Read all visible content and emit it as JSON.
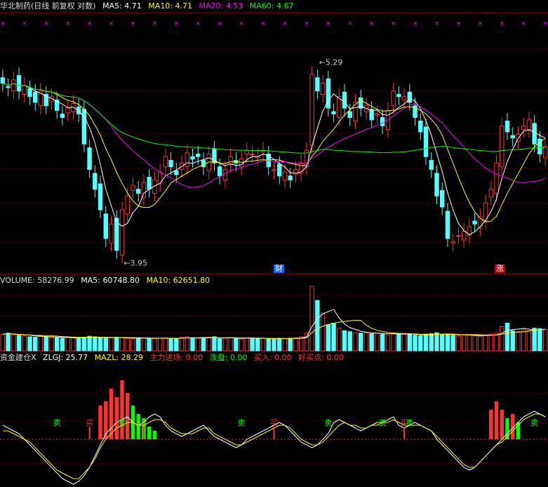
{
  "header": {
    "stock_title": "华北制药(日线 前复权 对数)",
    "ma5": "MA5: 4.71",
    "ma10": "MA10: 4.71",
    "ma20": "MA20: 4.53",
    "ma60": "MA60: 4.67"
  },
  "volume_header": {
    "volume": "VOLUME: 58276.99",
    "ma5": "MA5: 60748.80",
    "ma10": "MA10: 62651.80"
  },
  "indicator_header": {
    "name": "资金建仓X",
    "zlgj": "ZLGJ: 25.77",
    "mazl": "MAZL: 28.29",
    "zljc": "主力进场: 0.00",
    "xp": "洗盘: 0.00",
    "mr": "买入: 0.00",
    "hmd": "好买点: 0.00"
  },
  "annotations": {
    "high": "5.29",
    "low": "3.95",
    "cai": "财",
    "zhang": "涨",
    "sell": "卖",
    "buy": "买"
  },
  "colors": {
    "up": "#ff3232",
    "down": "#54ffff",
    "ma5": "#ffffff",
    "ma10": "#ffff00",
    "ma20": "#ff00ff",
    "ma60": "#00ff00",
    "grid": "#8b0000",
    "sell": "#00ff00",
    "buy": "#ff3232"
  },
  "chart_data": {
    "type": "candlestick",
    "panels": [
      "price",
      "volume",
      "indicator"
    ],
    "price_range": [
      3.55,
      5.5
    ],
    "close": [
      4.92,
      4.88,
      4.95,
      4.85,
      4.9,
      4.8,
      4.75,
      4.85,
      4.72,
      4.8,
      4.68,
      4.62,
      4.7,
      4.74,
      4.65,
      4.4,
      4.2,
      4.05,
      3.9,
      3.7,
      3.8,
      3.62,
      3.9,
      4.0,
      4.08,
      4.02,
      4.1,
      4.05,
      4.12,
      4.18,
      4.3,
      4.22,
      4.16,
      4.25,
      4.33,
      4.28,
      4.3,
      4.22,
      4.32,
      4.25,
      4.15,
      4.2,
      4.3,
      4.25,
      4.28,
      4.35,
      4.32,
      4.3,
      4.35,
      4.22,
      4.2,
      4.15,
      4.18,
      4.12,
      4.2,
      4.25,
      4.35,
      5.0,
      4.85,
      4.92,
      4.7,
      4.65,
      4.8,
      4.7,
      4.62,
      4.75,
      4.7,
      4.72,
      4.6,
      4.65,
      4.55,
      4.68,
      4.85,
      4.8,
      4.8,
      4.75,
      4.62,
      4.5,
      4.3,
      4.2,
      4.0,
      3.92,
      3.7,
      3.68,
      3.72,
      3.75,
      3.78,
      3.8,
      3.85,
      3.95,
      4.05,
      4.25,
      4.55,
      4.5,
      4.45,
      4.48,
      4.55,
      4.6,
      4.4,
      4.32,
      4.38
    ],
    "volume": [
      33,
      35,
      32,
      31,
      30,
      28,
      27,
      29,
      28,
      27,
      26,
      25,
      27,
      26,
      25,
      27,
      29,
      28,
      26,
      25,
      26,
      27,
      26,
      25,
      24,
      25,
      26,
      25,
      24,
      25,
      26,
      25,
      24,
      27,
      28,
      26,
      25,
      26,
      27,
      28,
      24,
      25,
      26,
      25,
      24,
      26,
      25,
      24,
      25,
      23,
      24,
      25,
      24,
      25,
      26,
      28,
      35,
      128,
      100,
      75,
      52,
      55,
      45,
      40,
      38,
      36,
      35,
      36,
      34,
      35,
      33,
      32,
      35,
      34,
      33,
      32,
      31,
      30,
      33,
      34,
      36,
      32,
      33,
      31,
      30,
      32,
      31,
      30,
      29,
      31,
      33,
      35,
      48,
      55,
      40,
      38,
      42,
      40,
      45,
      44,
      42
    ],
    "zlgj": [
      5,
      4,
      3,
      2,
      0,
      -2,
      -4,
      -6,
      -8,
      -10,
      -12,
      -14,
      -15,
      -16,
      -15,
      -13,
      -10,
      -6,
      -2,
      2,
      4,
      6,
      7,
      8,
      6,
      5,
      6,
      8,
      9,
      8,
      5,
      3,
      2,
      1,
      2,
      3,
      4,
      5,
      3,
      1,
      0,
      -1,
      -2,
      -3,
      -2,
      0,
      1,
      2,
      3,
      4,
      5,
      6,
      5,
      3,
      1,
      -1,
      -2,
      -3,
      -2,
      0,
      2,
      6,
      7,
      6,
      5,
      4,
      3,
      4,
      5,
      6,
      6,
      7,
      8,
      5,
      4,
      5,
      6,
      5,
      4,
      3,
      0,
      -2,
      -4,
      -6,
      -8,
      -10,
      -11,
      -10,
      -8,
      -6,
      -4,
      -2,
      0,
      2,
      4,
      6,
      8,
      9,
      10,
      9,
      8
    ],
    "mazl": [
      3,
      3,
      2,
      1,
      0,
      -1,
      -3,
      -5,
      -7,
      -9,
      -11,
      -12,
      -13,
      -14,
      -14,
      -12,
      -10,
      -7,
      -3,
      0,
      2,
      4,
      5,
      6,
      6,
      5,
      5,
      6,
      7,
      7,
      6,
      4,
      3,
      2,
      2,
      2,
      3,
      4,
      4,
      2,
      1,
      0,
      -1,
      -2,
      -2,
      -1,
      0,
      1,
      2,
      3,
      4,
      5,
      5,
      4,
      2,
      0,
      -1,
      -2,
      -2,
      -1,
      1,
      3,
      5,
      6,
      5,
      5,
      4,
      4,
      5,
      5,
      6,
      6,
      7,
      6,
      5,
      5,
      5,
      5,
      4,
      3,
      1,
      -1,
      -3,
      -5,
      -7,
      -9,
      -10,
      -10,
      -8,
      -6,
      -4,
      -2,
      -1,
      1,
      3,
      5,
      7,
      8,
      9,
      9,
      8
    ],
    "buy_bars": [
      0,
      0,
      0,
      0,
      0,
      0,
      0,
      0,
      0,
      0,
      0,
      0,
      0,
      0,
      0,
      0,
      0,
      0,
      8,
      9,
      12,
      10,
      14,
      11,
      0,
      0,
      0,
      0,
      0,
      0,
      0,
      0,
      0,
      0,
      0,
      0,
      0,
      0,
      0,
      0,
      0,
      0,
      0,
      0,
      0,
      0,
      0,
      0,
      0,
      0,
      0,
      0,
      0,
      0,
      0,
      0,
      0,
      0,
      0,
      0,
      0,
      0,
      0,
      0,
      0,
      0,
      0,
      0,
      0,
      0,
      0,
      0,
      0,
      0,
      0,
      0,
      0,
      0,
      0,
      0,
      0,
      0,
      0,
      0,
      0,
      0,
      0,
      0,
      0,
      0,
      7,
      9,
      7,
      0,
      6,
      0,
      0,
      0,
      0,
      0,
      0
    ],
    "sell_bars": [
      0,
      0,
      0,
      0,
      0,
      0,
      0,
      0,
      0,
      0,
      0,
      0,
      0,
      0,
      0,
      0,
      0,
      0,
      0,
      0,
      0,
      0,
      0,
      0,
      8,
      6,
      5,
      3,
      2,
      0,
      0,
      0,
      0,
      0,
      0,
      0,
      0,
      0,
      0,
      0,
      0,
      0,
      0,
      0,
      0,
      0,
      0,
      0,
      0,
      0,
      0,
      0,
      0,
      0,
      0,
      0,
      0,
      0,
      0,
      0,
      0,
      0,
      0,
      0,
      0,
      0,
      0,
      0,
      0,
      0,
      0,
      0,
      0,
      0,
      0,
      0,
      0,
      0,
      0,
      0,
      0,
      0,
      0,
      0,
      0,
      0,
      0,
      0,
      0,
      0,
      0,
      0,
      0,
      5,
      0,
      4,
      0,
      0,
      0,
      0,
      0
    ]
  }
}
